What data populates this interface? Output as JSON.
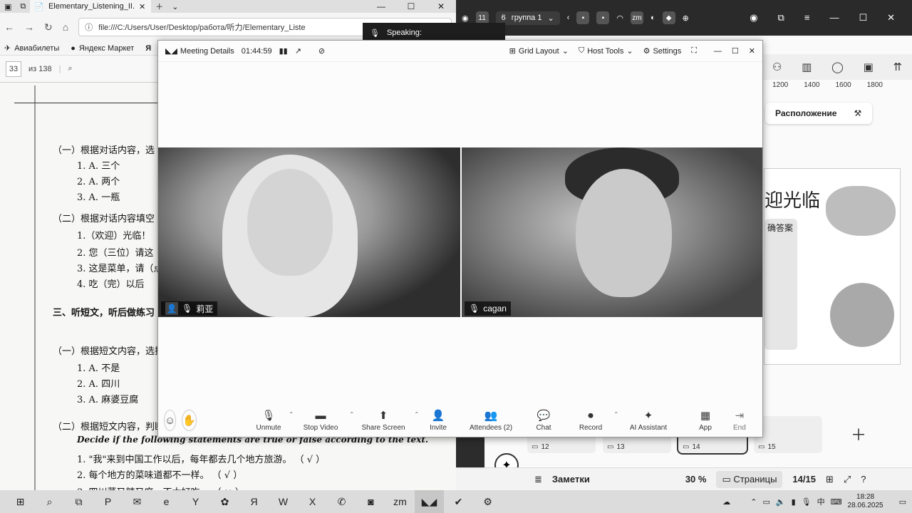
{
  "browser": {
    "tab_title": "Elementary_Listening_II.",
    "url": "file:///C:/Users/User/Desktop/работа/听力/Elementary_Liste",
    "bookmarks": [
      "Авиабилеты",
      "Яндекс Маркет",
      "Я"
    ],
    "page_number": "33",
    "page_total": "из 138"
  },
  "pdf": {
    "lines": [
      "（一）根据对话内容，选",
      "1. A. 三个",
      "2. A. 两个",
      "3. A. 一瓶",
      "（二）根据对话内容填空",
      "1.（欢迎）光临！",
      "2. 您（三位）请这",
      "3. 这是菜单，请（点",
      "4. 吃（完）以后",
      "三、听短文，听后做练习",
      "（一）根据短文内容，选择",
      "1. A. 不是",
      "2. A. 四川",
      "3. A. 麻婆豆腐",
      "（二）根据短文内容，判断",
      "Decide if the following statements are true or false according to the text.",
      "1. \"我\"来到中国工作以后，每年都去几个地方旅游。 （ √ ）",
      "2. 每个地方的菜味道都不一样。 （ √ ）",
      "3. 四川菜又辣又麻，不太好吃。 （ × ）"
    ]
  },
  "speaking": {
    "label": "Speaking:"
  },
  "zoom": {
    "meeting_details": "Meeting Details",
    "timer": "01:44:59",
    "grid_layout": "Grid Layout",
    "host_tools": "Host Tools",
    "settings": "Settings",
    "participants": [
      {
        "name": "莉亚"
      },
      {
        "name": "cagan"
      }
    ],
    "controls": [
      {
        "label": "Unmute",
        "icon": "mic-off-icon",
        "glyph": "🎙"
      },
      {
        "label": "Stop Video",
        "icon": "video-icon",
        "glyph": "▬"
      },
      {
        "label": "Share Screen",
        "icon": "share-screen-icon",
        "glyph": "⬆"
      },
      {
        "label": "Invite",
        "icon": "invite-icon",
        "glyph": "👤"
      },
      {
        "label": "Attendees (2)",
        "icon": "attendees-icon",
        "glyph": "👥"
      },
      {
        "label": "Chat",
        "icon": "chat-icon",
        "glyph": "💬"
      },
      {
        "label": "Record",
        "icon": "record-icon",
        "glyph": "⏺"
      },
      {
        "label": "AI Assistant",
        "icon": "ai-assistant-icon",
        "glyph": "✦"
      },
      {
        "label": "App",
        "icon": "apps-icon",
        "glyph": "▦"
      }
    ],
    "end_label": "End"
  },
  "rightapp": {
    "tab_count": "11",
    "group_count": "6",
    "group_name": "группа 1",
    "ruler": [
      "1200",
      "1400",
      "1600",
      "1800"
    ],
    "layout_label": "Расположение",
    "slide_title": "迎光临",
    "slide_answers": "确答案",
    "thumbs": [
      {
        "num": "12"
      },
      {
        "num": "13"
      },
      {
        "num": "14"
      },
      {
        "num": "15"
      }
    ],
    "status": {
      "notes": "Заметки",
      "zoom": "30 %",
      "pages": "Страницы",
      "page_pos": "14/15"
    }
  },
  "taskbar": {
    "time": "18:28",
    "date": "28.06.2025",
    "lang": "中"
  }
}
